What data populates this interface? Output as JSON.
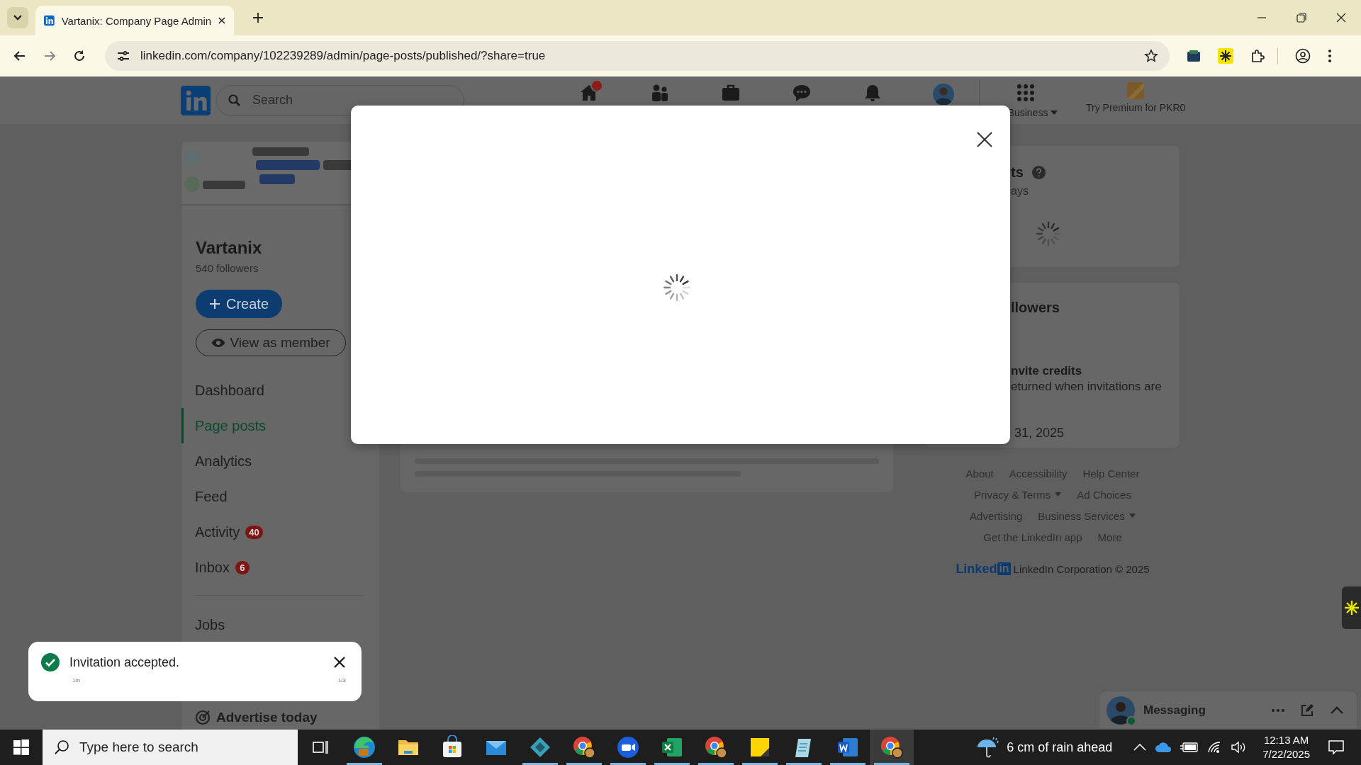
{
  "browser": {
    "tab_title": "Vartanix: Company Page Admin",
    "url": "linkedin.com/company/102239289/admin/page-posts/published/?share=true"
  },
  "topnav": {
    "search": {
      "placeholder": "Search"
    },
    "icons": [
      {
        "kind": "home",
        "badge": true
      },
      {
        "kind": "network",
        "badge": false
      },
      {
        "kind": "jobs",
        "badge": false
      },
      {
        "kind": "messaging",
        "badge": false
      },
      {
        "kind": "notifications",
        "badge": false
      },
      {
        "kind": "profile",
        "badge": false
      }
    ],
    "business_label": "Business",
    "premium_label": "Try Premium for PKR0"
  },
  "sidebar": {
    "name": "Vartanix",
    "followers": "540 followers",
    "create_button": "Create",
    "view_button": "View as member",
    "items": [
      {
        "label": "Dashboard",
        "selected": false
      },
      {
        "label": "Page posts",
        "selected": true
      },
      {
        "label": "Analytics",
        "selected": false
      },
      {
        "label": "Feed",
        "selected": false
      },
      {
        "label": "Activity",
        "selected": false,
        "badge": "40"
      },
      {
        "label": "Inbox",
        "selected": false,
        "badge": "6"
      }
    ],
    "more_items": [
      {
        "label": "Jobs",
        "selected": false
      }
    ],
    "advertise": "Advertise today"
  },
  "modal": {
    "loading": true
  },
  "analytics_card": {
    "title": "ts",
    "subtitle": "ays",
    "loading": true
  },
  "invite_card": {
    "title": "llowers",
    "credits_title": "nvite credits",
    "credits_text": "eturned when invitations are",
    "date": "31, 2025"
  },
  "footer": {
    "rows": [
      [
        {
          "label": "About",
          "menu": false
        },
        {
          "label": "Accessibility",
          "menu": false
        },
        {
          "label": "Help Center",
          "menu": false
        }
      ],
      [
        {
          "label": "Privacy & Terms",
          "menu": true
        },
        {
          "label": "Ad Choices",
          "menu": false
        }
      ],
      [
        {
          "label": "Advertising",
          "menu": false
        },
        {
          "label": "Business Services",
          "menu": true
        }
      ],
      [
        {
          "label": "Get the LinkedIn app",
          "menu": false
        },
        {
          "label": "More",
          "menu": false
        }
      ]
    ],
    "logo_word": "Linked",
    "logo_box": "in",
    "copyright": "LinkedIn Corporation © 2025"
  },
  "toast": {
    "kind": "success",
    "message": "Invitation accepted.",
    "time": "1m",
    "counter": "1/3"
  },
  "messaging": {
    "label": "Messaging",
    "online": true
  },
  "taskbar": {
    "search_placeholder": "Type here to search",
    "apps": [
      {
        "kind": "edge",
        "running": true,
        "active": false
      },
      {
        "kind": "explorer",
        "running": false,
        "active": false
      },
      {
        "kind": "store",
        "running": false,
        "active": false
      },
      {
        "kind": "mail",
        "running": false,
        "active": false
      },
      {
        "kind": "diamond",
        "running": true,
        "active": false
      },
      {
        "kind": "chrome",
        "running": true,
        "active": false
      },
      {
        "kind": "zoom",
        "running": true,
        "active": false
      },
      {
        "kind": "excel",
        "running": true,
        "active": false
      },
      {
        "kind": "chrome",
        "running": true,
        "active": false
      },
      {
        "kind": "sticky",
        "running": true,
        "active": false
      },
      {
        "kind": "notepad",
        "running": true,
        "active": false
      },
      {
        "kind": "word",
        "running": true,
        "active": false
      },
      {
        "kind": "chrome",
        "running": true,
        "active": true
      }
    ],
    "weather": "6 cm of rain ahead",
    "time": "12:13 AM",
    "date": "7/22/2025"
  }
}
